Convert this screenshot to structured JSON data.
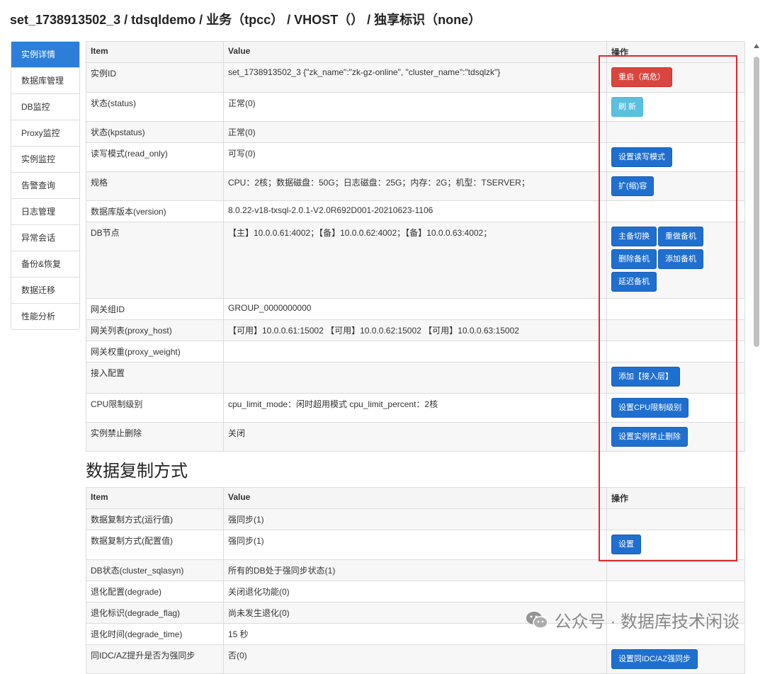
{
  "header": {
    "title": "set_1738913502_3 / tdsqldemo / 业务（tpcc） / VHOST（） / 独享标识（none）"
  },
  "sidebar": {
    "items": [
      {
        "label": "实例详情",
        "active": true
      },
      {
        "label": "数据库管理"
      },
      {
        "label": "DB监控"
      },
      {
        "label": "Proxy监控"
      },
      {
        "label": "实例监控"
      },
      {
        "label": "告警查询"
      },
      {
        "label": "日志管理"
      },
      {
        "label": "异常会话"
      },
      {
        "label": "备份&恢复"
      },
      {
        "label": "数据迁移"
      },
      {
        "label": "性能分析"
      }
    ]
  },
  "table1": {
    "headers": {
      "item": "Item",
      "value": "Value",
      "action": "操作"
    },
    "rows": [
      {
        "item": "实例ID",
        "value": "set_1738913502_3 {\"zk_name\":\"zk-gz-online\", \"cluster_name\":\"tdsqlzk\"}",
        "buttons": [
          {
            "label": "重启（高危）",
            "style": "red"
          }
        ]
      },
      {
        "item": "状态(status)",
        "value": "正常(0)",
        "buttons": [
          {
            "label": "刷 新",
            "style": "cyan"
          }
        ]
      },
      {
        "item": "状态(kpstatus)",
        "value": "正常(0)",
        "buttons": []
      },
      {
        "item": "读写模式(read_only)",
        "value": "可写(0)",
        "buttons": [
          {
            "label": "设置读写模式",
            "style": "blue"
          }
        ]
      },
      {
        "item": "规格",
        "value": "CPU：2核；数据磁盘：50G；日志磁盘：25G；内存：2G；机型：TSERVER；",
        "buttons": [
          {
            "label": "扩(缩)容",
            "style": "blue"
          }
        ]
      },
      {
        "item": "数据库版本(version)",
        "value": "8.0.22-v18-txsql-2.0.1-V2.0R692D001-20210623-1106",
        "buttons": []
      },
      {
        "item": "DB节点",
        "value": "【主】10.0.0.61:4002；【备】10.0.0.62:4002；【备】10.0.0.63:4002；",
        "buttons": [
          {
            "label": "主备切换",
            "style": "blue"
          },
          {
            "label": "重做备机",
            "style": "blue"
          },
          {
            "label": "删除备机",
            "style": "blue"
          },
          {
            "label": "添加备机",
            "style": "blue"
          },
          {
            "label": "延迟备机",
            "style": "blue"
          }
        ]
      },
      {
        "item": "网关组ID",
        "value": "GROUP_0000000000",
        "buttons": []
      },
      {
        "item": "网关列表(proxy_host)",
        "value": "【可用】10.0.0.61:15002 【可用】10.0.0.62:15002 【可用】10.0.0.63:15002",
        "buttons": []
      },
      {
        "item": "网关权重(proxy_weight)",
        "value": "",
        "buttons": []
      },
      {
        "item": "接入配置",
        "value": "",
        "buttons": [
          {
            "label": "添加【接入层】",
            "style": "blue"
          }
        ]
      },
      {
        "item": "CPU限制级别",
        "value": "cpu_limit_mode：闲时超用模式 cpu_limit_percent：2核",
        "buttons": [
          {
            "label": "设置CPU限制级别",
            "style": "blue"
          }
        ]
      },
      {
        "item": "实例禁止删除",
        "value": "关闭",
        "buttons": [
          {
            "label": "设置实例禁止删除",
            "style": "blue"
          }
        ]
      }
    ]
  },
  "section2": {
    "title": "数据复制方式"
  },
  "table2": {
    "headers": {
      "item": "Item",
      "value": "Value",
      "action": "操作"
    },
    "rows": [
      {
        "item": "数据复制方式(运行值)",
        "value": "强同步(1)",
        "buttons": []
      },
      {
        "item": "数据复制方式(配置值)",
        "value": "强同步(1)",
        "buttons": [
          {
            "label": "设置",
            "style": "blue"
          }
        ]
      },
      {
        "item": "DB状态(cluster_sqlasyn)",
        "value": "所有的DB处于强同步状态(1)",
        "buttons": []
      },
      {
        "item": "退化配置(degrade)",
        "value": "关闭退化功能(0)",
        "buttons": []
      },
      {
        "item": "退化标识(degrade_flag)",
        "value": "尚未发生退化(0)",
        "buttons": []
      },
      {
        "item": "退化时间(degrade_time)",
        "value": "15 秒",
        "buttons": []
      },
      {
        "item": "同IDC/AZ提升是否为强同步",
        "value": "否(0)",
        "buttons": [
          {
            "label": "设置同IDC/AZ强同步",
            "style": "blue"
          }
        ]
      }
    ]
  },
  "watermark": {
    "text": "公众号 · 数据库技术闲谈"
  }
}
